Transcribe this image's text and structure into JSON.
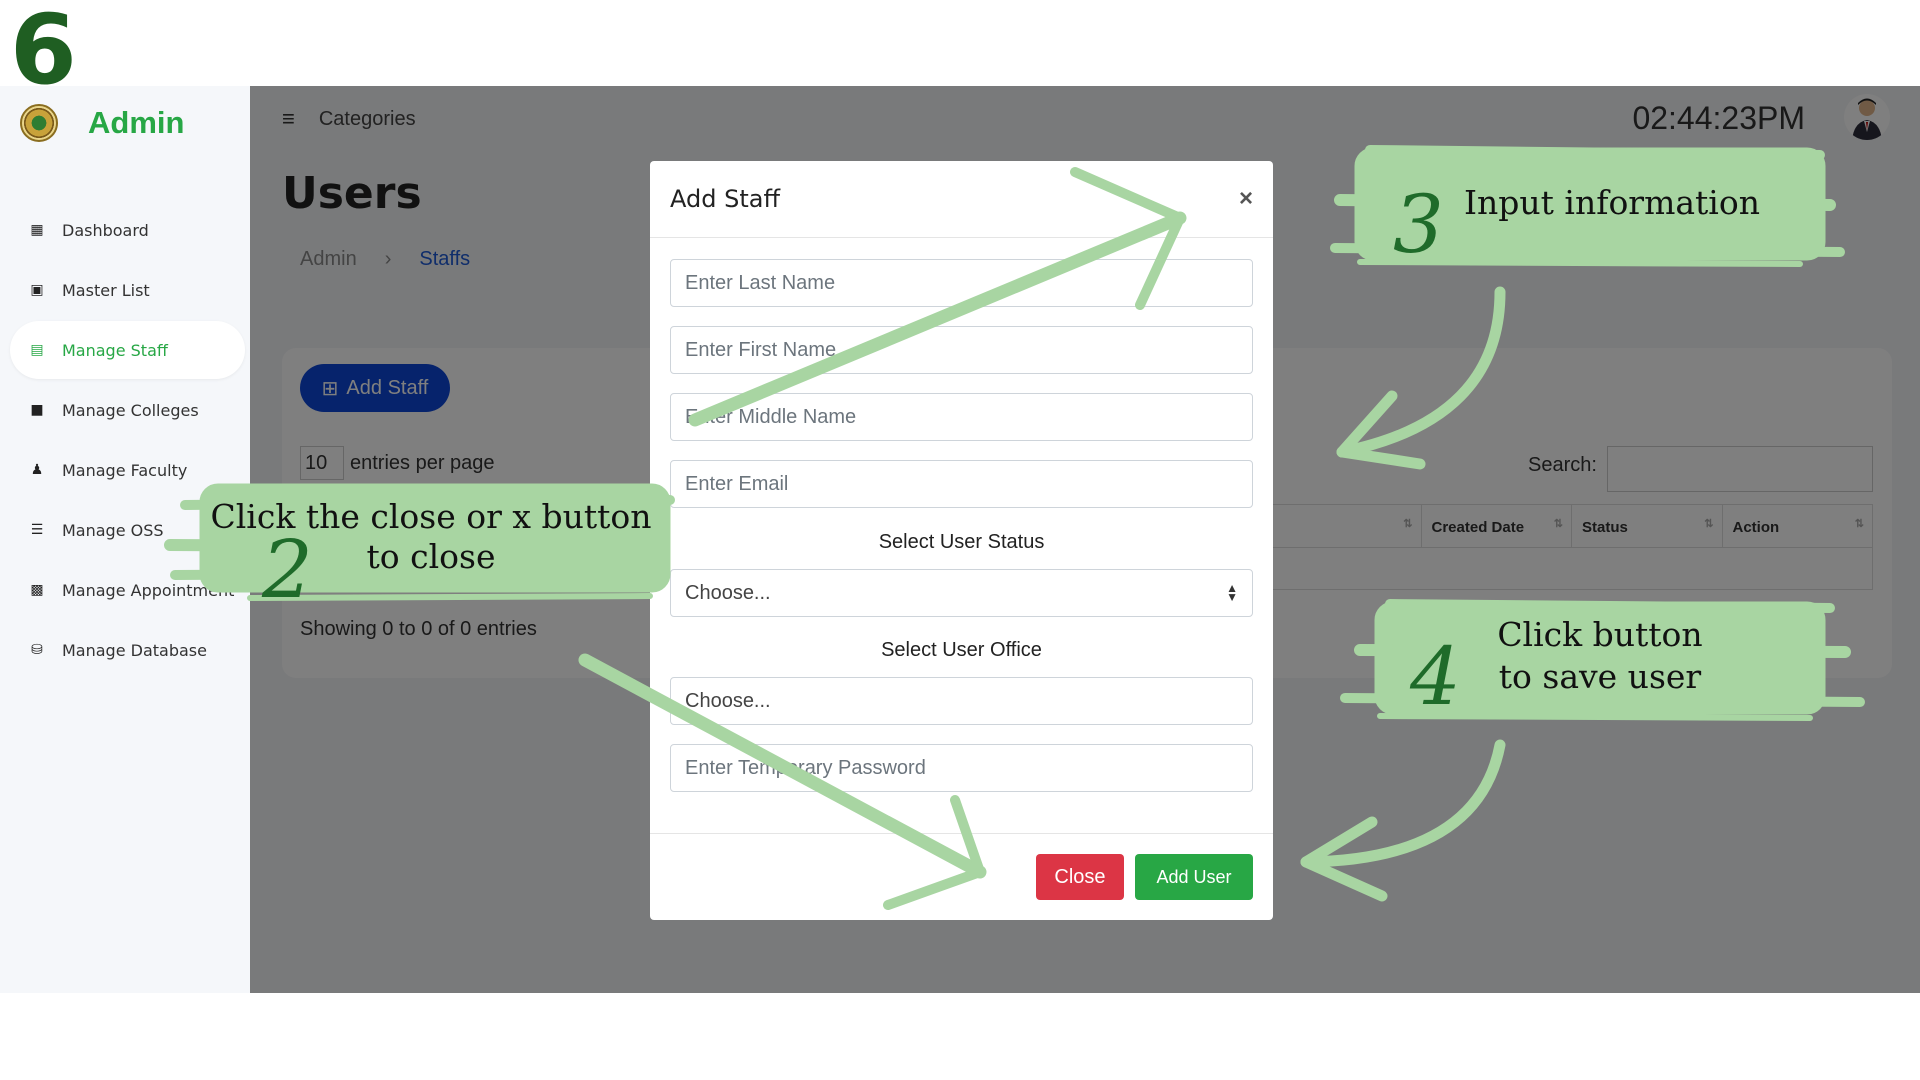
{
  "step_number": "6",
  "sidebar": {
    "brand": "Admin",
    "items": [
      {
        "label": "Dashboard",
        "icon": "dashboard-icon",
        "active": false
      },
      {
        "label": "Master List",
        "icon": "id-card-icon",
        "active": false
      },
      {
        "label": "Manage Staff",
        "icon": "staff-card-icon",
        "active": true
      },
      {
        "label": "Manage Colleges",
        "icon": "book-icon",
        "active": false
      },
      {
        "label": "Manage Faculty",
        "icon": "user-icon",
        "active": false
      },
      {
        "label": "Manage OSS",
        "icon": "user-list-icon",
        "active": false
      },
      {
        "label": "Manage Appointment",
        "icon": "calendar-icon",
        "active": false
      },
      {
        "label": "Manage Database",
        "icon": "database-icon",
        "active": false
      }
    ]
  },
  "topbar": {
    "categories": "Categories",
    "clock": "02:44:23PM"
  },
  "page": {
    "title": "Users",
    "breadcrumb": [
      "Admin",
      "Staffs"
    ],
    "add_staff_label": "Add Staff",
    "entries_value": "10",
    "entries_label": "entries per page",
    "search_label": "Search:",
    "columns": [
      "Created Date",
      "Status",
      "Action"
    ],
    "showing": "Showing 0 to 0 of 0 entries"
  },
  "modal": {
    "title": "Add Staff",
    "close_x": "×",
    "last_name_placeholder": "Enter Last Name",
    "first_name_placeholder": "Enter First Name",
    "middle_name_placeholder": "Enter Middle Name",
    "email_placeholder": "Enter Email",
    "status_label": "Select User Status",
    "status_value": "Choose...",
    "office_label": "Select User Office",
    "office_value": "Choose...",
    "password_placeholder": "Enter Temporary Password",
    "close_label": "Close",
    "add_user_label": "Add User"
  },
  "annotations": {
    "two_num": "2",
    "two_text": "Click the close or x button to close",
    "three_num": "3",
    "three_text": "Input information",
    "four_num": "4",
    "four_text_line1": "Click button",
    "four_text_line2": "to save user",
    "highlight_color": "#a8d5a2"
  }
}
